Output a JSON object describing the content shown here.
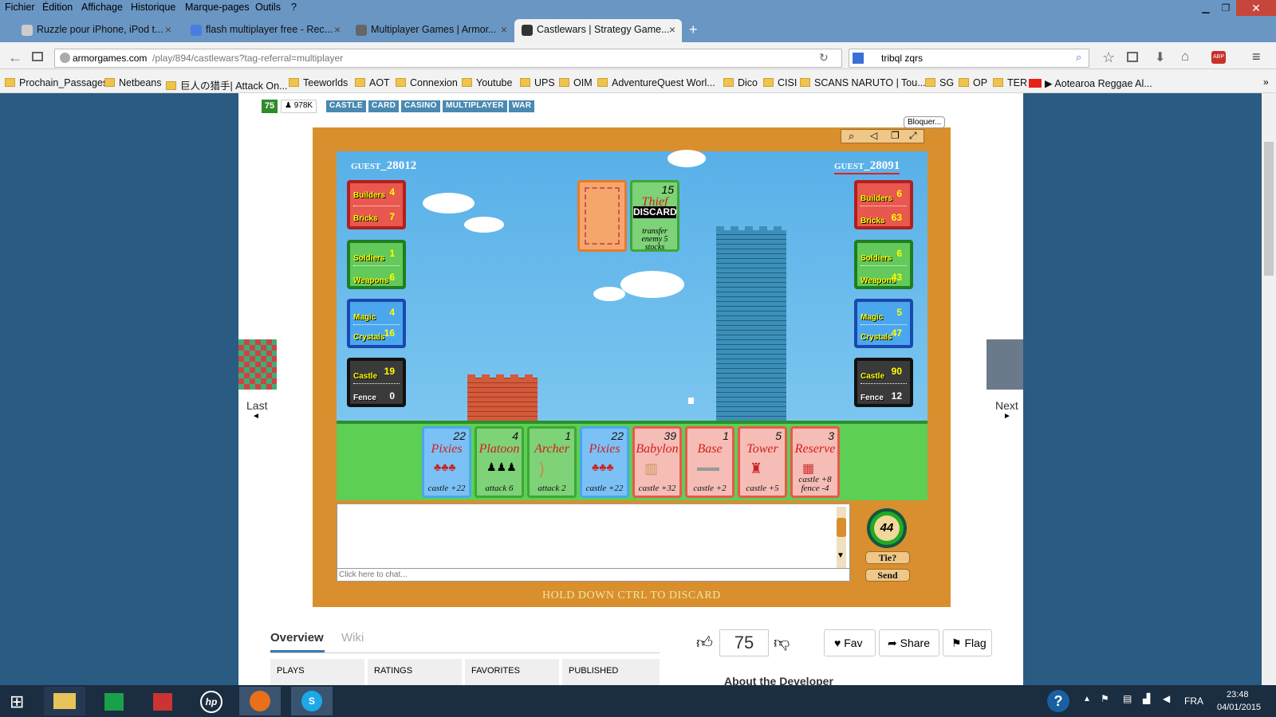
{
  "menubar": {
    "items": [
      "Fichier",
      "Édition",
      "Affichage",
      "Historique",
      "Marque-pages",
      "Outils",
      "?"
    ]
  },
  "tabs": [
    {
      "label": "Ruzzle pour iPhone, iPod t...",
      "icon": "apple-icon"
    },
    {
      "label": "flash multiplayer free - Rec...",
      "icon": "google-icon"
    },
    {
      "label": "Multiplayer Games | Armor...",
      "icon": "shield-icon"
    },
    {
      "label": "Castlewars | Strategy Game...",
      "icon": "shield-icon",
      "active": true
    }
  ],
  "nav": {
    "url_host": "armorgames.com",
    "url_path": "/play/894/castlewars?tag-referral=multiplayer",
    "search": "tribql zqrs"
  },
  "bookmarks": [
    "Prochain_Passages",
    "Netbeans",
    "巨人の猎手| Attack On...",
    "Teeworlds",
    "AOT",
    "Connexion",
    "Youtube",
    "UPS",
    "OIM",
    "AdventureQuest Worl...",
    "Dico",
    "CISI",
    "SCANS NARUTO | Tou...",
    "SG",
    "OP",
    "TER",
    "Aotearoa Reggae Al..."
  ],
  "game_header": {
    "rating": "75",
    "plays": "978K",
    "tags": [
      "CASTLE",
      "CARD",
      "CASINO",
      "MULTIPLAYER",
      "WAR"
    ],
    "block": "Bloquer..."
  },
  "players": {
    "left": {
      "name": "guest_28012",
      "builders": "4",
      "bricks": "7",
      "soldiers": "1",
      "weapons": "6",
      "magic": "4",
      "crystals": "16",
      "castle": "19",
      "fence": "0"
    },
    "right": {
      "name": "guest_28091",
      "builders": "6",
      "bricks": "63",
      "soldiers": "6",
      "weapons": "43",
      "magic": "5",
      "crystals": "47",
      "castle": "90",
      "fence": "12"
    }
  },
  "labels": {
    "builders": "Builders",
    "bricks": "Bricks",
    "soldiers": "Soldiers",
    "weapons": "Weapons",
    "magic": "Magic",
    "crystals": "Crystals",
    "castle": "Castle",
    "fence": "Fence"
  },
  "played_card": {
    "cost": "15",
    "name": "Thief",
    "stamp": "DISCARD",
    "effect": "transfer enemy 5 stocks"
  },
  "hand": [
    {
      "cost": "22",
      "name": "Pixies",
      "effect": "castle +22",
      "color": "blue"
    },
    {
      "cost": "4",
      "name": "Platoon",
      "effect": "attack 6",
      "color": "green"
    },
    {
      "cost": "1",
      "name": "Archer",
      "effect": "attack 2",
      "color": "green"
    },
    {
      "cost": "22",
      "name": "Pixies",
      "effect": "castle +22",
      "color": "blue"
    },
    {
      "cost": "39",
      "name": "Babylon",
      "effect": "castle +32",
      "color": "red"
    },
    {
      "cost": "1",
      "name": "Base",
      "effect": "castle +2",
      "color": "red"
    },
    {
      "cost": "5",
      "name": "Tower",
      "effect": "castle +5",
      "color": "red"
    },
    {
      "cost": "3",
      "name": "Reserve",
      "effect": "castle +8 fence -4",
      "color": "red"
    }
  ],
  "chat": {
    "placeholder": "Click here to chat...",
    "timer": "44",
    "tie": "Tie?",
    "send": "Send",
    "hint": "HOLD DOWN CTRL TO DISCARD"
  },
  "side_nav": {
    "last": "Last",
    "next": "Next"
  },
  "overview": {
    "tab1": "Overview",
    "tab2": "Wiki",
    "cols": [
      "PLAYS",
      "RATINGS",
      "FAVORITES",
      "PUBLISHED"
    ],
    "score": "75",
    "fav": "Fav",
    "share": "Share",
    "flag": "Flag",
    "about": "About the Developer"
  },
  "taskbar": {
    "lang": "FRA",
    "time": "23:48",
    "date": "04/01/2015"
  },
  "colors": {
    "red_card": "#e8584e",
    "green_card": "#63c95a",
    "blue_card": "#4aa7ee",
    "accent": "#d98f2e"
  }
}
